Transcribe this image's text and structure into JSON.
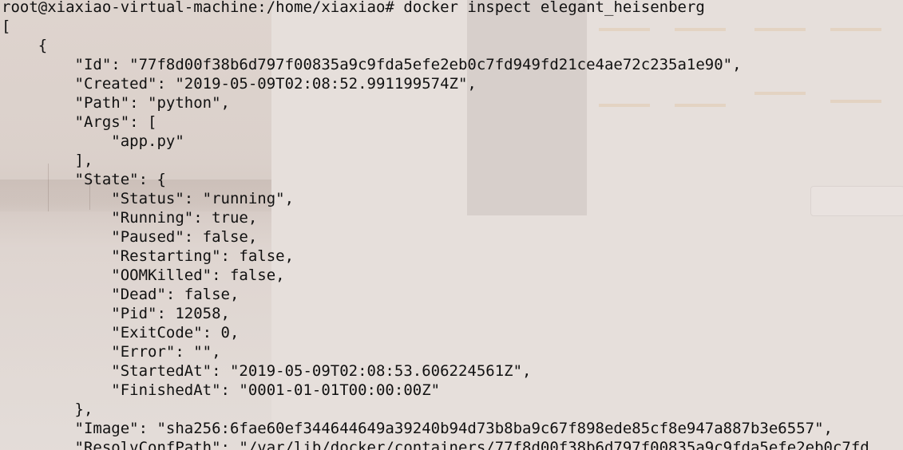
{
  "terminal": {
    "prompt": "root@xiaxiao-virtual-machine:/home/xiaxiao#",
    "command": "docker inspect elegant_heisenberg",
    "output_lines": [
      "[",
      "    {",
      "        \"Id\": \"77f8d00f38b6d797f00835a9c9fda5efe2eb0c7fd949fd21ce4ae72c235a1e90\",",
      "        \"Created\": \"2019-05-09T02:08:52.991199574Z\",",
      "        \"Path\": \"python\",",
      "        \"Args\": [",
      "            \"app.py\"",
      "        ],",
      "        \"State\": {",
      "            \"Status\": \"running\",",
      "            \"Running\": true,",
      "            \"Paused\": false,",
      "            \"Restarting\": false,",
      "            \"OOMKilled\": false,",
      "            \"Dead\": false,",
      "            \"Pid\": 12058,",
      "            \"ExitCode\": 0,",
      "            \"Error\": \"\",",
      "            \"StartedAt\": \"2019-05-09T02:08:53.606224561Z\",",
      "            \"FinishedAt\": \"0001-01-01T00:00:00Z\"",
      "        },",
      "        \"Image\": \"sha256:6fae60ef344644649a39240b94d73b8ba9c67f898ede85cf8e947a887b3e6557\",",
      "        \"ResolvConfPath\": \"/var/lib/docker/containers/77f8d00f38b6d797f00835a9c9fda5efe2eb0c7fd"
    ]
  }
}
